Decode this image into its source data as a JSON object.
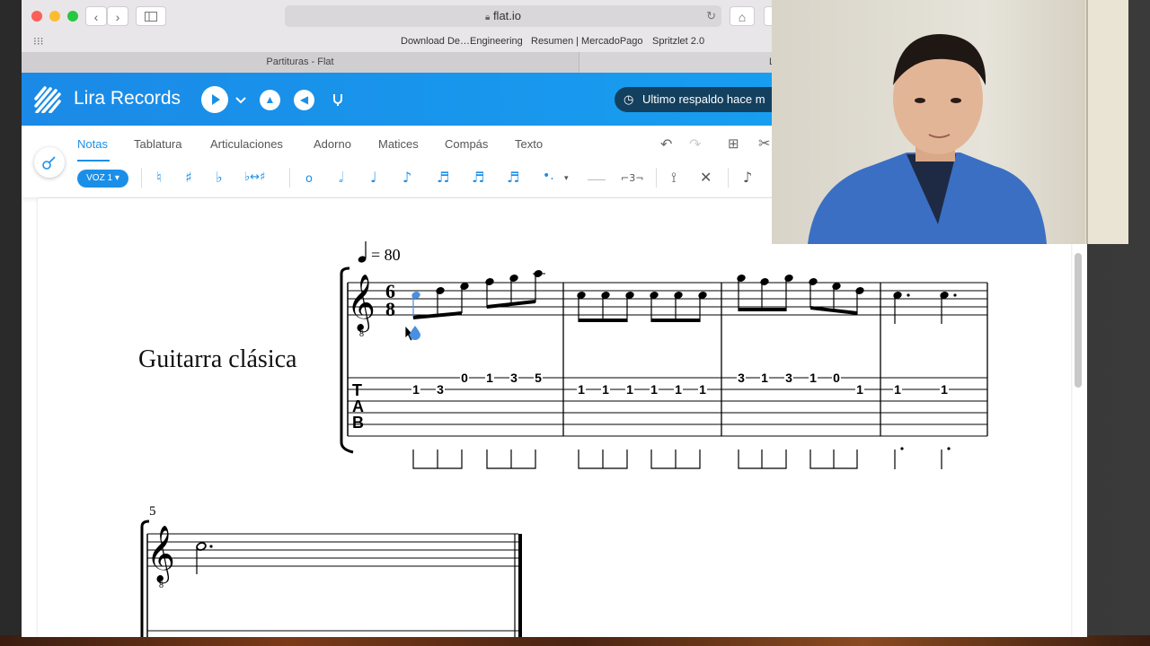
{
  "browser": {
    "url": "flat.io",
    "bookmarks": [
      "Download De…Engineering",
      "Resumen | MercadoPago",
      "Spritzlet 2.0"
    ],
    "tab_title": "Partituras - Flat",
    "tab_right_partial": "L"
  },
  "app": {
    "name": "Lira Records",
    "backup_status": "Ultimo respaldo hace m"
  },
  "toolbar": {
    "tabs": [
      "Notas",
      "Tablatura",
      "Articulaciones",
      "Adorno",
      "Matices",
      "Compás",
      "Texto"
    ],
    "active_tab": "Notas",
    "voice_label": "VOZ 1",
    "accidentals": [
      "♮",
      "♯",
      "♭",
      "♭↔♯"
    ],
    "durations": [
      "𝅝",
      "𝅗𝅥",
      "♩",
      "♪",
      "𝅘𝅥𝅯",
      "𝅘𝅥𝅰",
      "𝅘𝅥𝅱"
    ],
    "tuplet_label": "⌐3¬"
  },
  "score": {
    "tempo_value": "= 80",
    "instrument": "Guitarra clásica",
    "time_signature_top": "6",
    "time_signature_bottom": "8",
    "clef_octave": "8",
    "system2_measure_number": "5",
    "tab_letters": [
      "T",
      "A",
      "B"
    ],
    "tab_numbers": [
      {
        "text": "1",
        "string": 2
      },
      {
        "text": "3",
        "string": 2
      },
      {
        "text": "0",
        "string": 1
      },
      {
        "text": "1",
        "string": 1
      },
      {
        "text": "3",
        "string": 1
      },
      {
        "text": "5",
        "string": 1
      },
      {
        "text": "1",
        "string": 2
      },
      {
        "text": "1",
        "string": 2
      },
      {
        "text": "1",
        "string": 2
      },
      {
        "text": "1",
        "string": 2
      },
      {
        "text": "1",
        "string": 2
      },
      {
        "text": "1",
        "string": 2
      },
      {
        "text": "3",
        "string": 1
      },
      {
        "text": "1",
        "string": 1
      },
      {
        "text": "3",
        "string": 1
      },
      {
        "text": "1",
        "string": 1
      },
      {
        "text": "0",
        "string": 1
      },
      {
        "text": "1",
        "string": 2
      },
      {
        "text": "1",
        "string": 2
      },
      {
        "text": "1",
        "string": 2
      }
    ]
  }
}
